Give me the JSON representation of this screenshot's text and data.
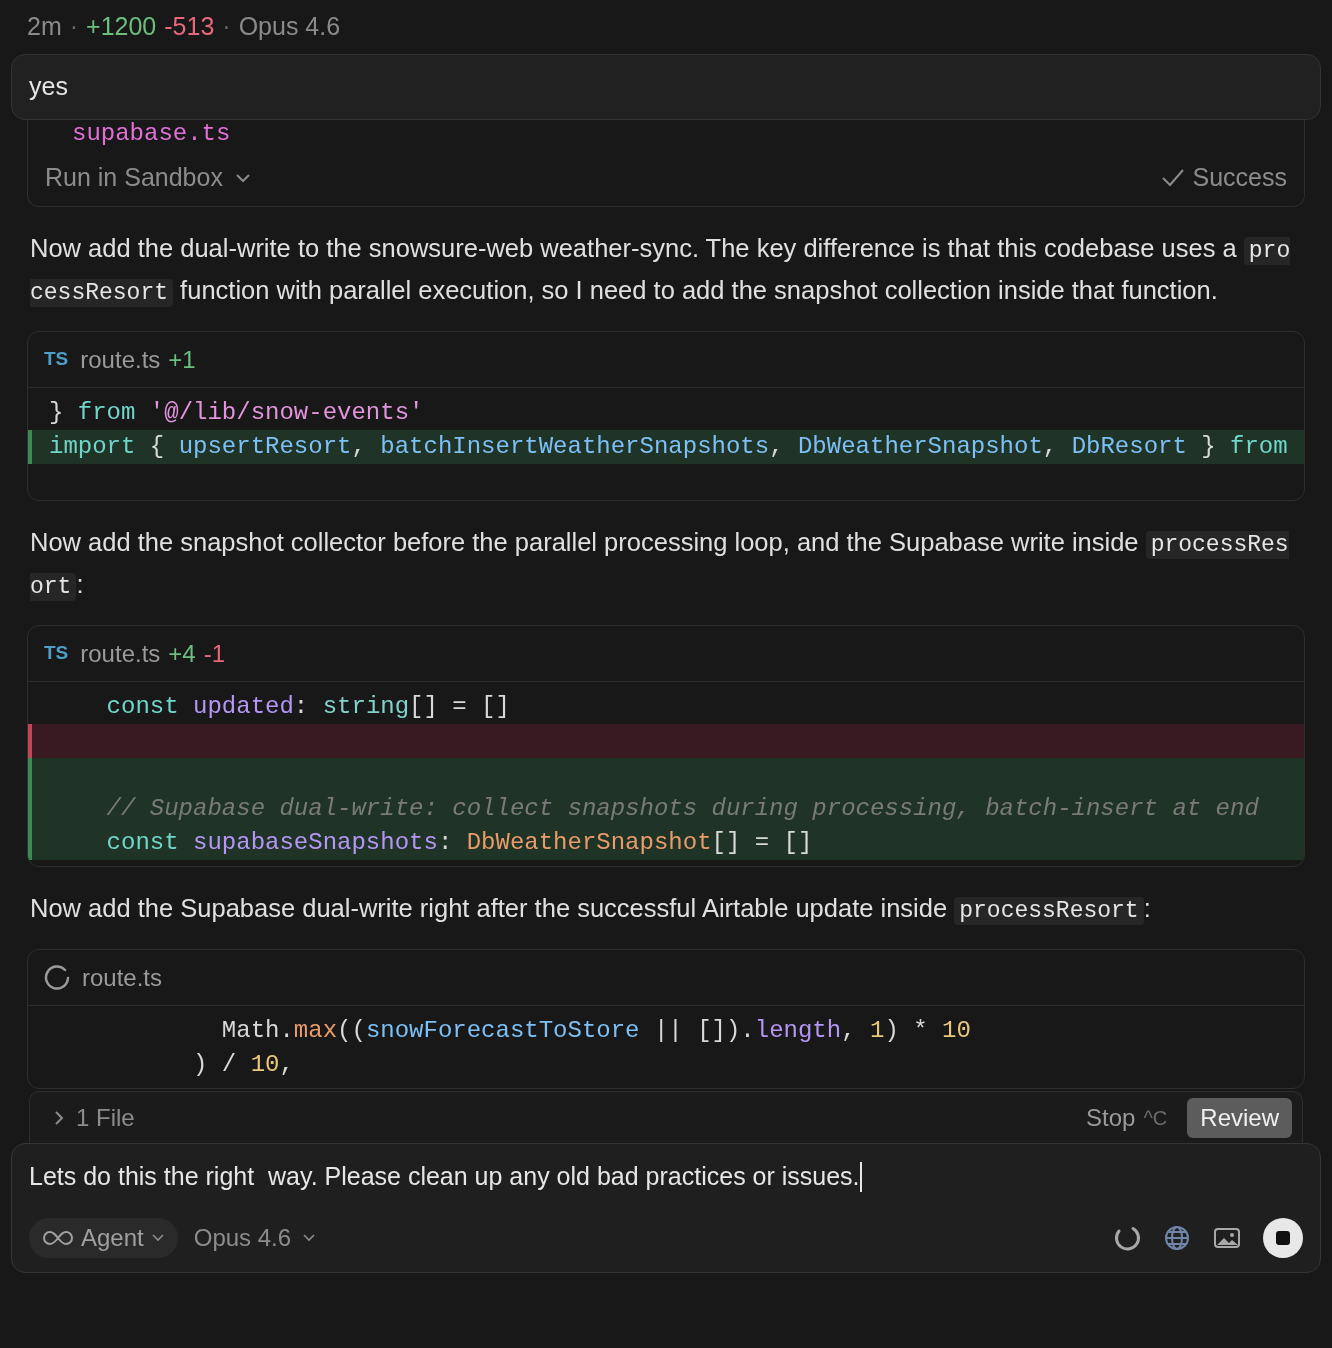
{
  "meta": [
    {
      "kind": "muted",
      "text": "2m"
    },
    {
      "kind": "sep",
      "text": "·"
    },
    {
      "kind": "added",
      "text": "+1200"
    },
    {
      "kind": "removed",
      "text": "-513"
    },
    {
      "kind": "sep",
      "text": "·"
    },
    {
      "kind": "muted",
      "text": "Opus 4.6"
    }
  ],
  "user_message": "yes",
  "tool_card": {
    "code_line": "supabase.ts",
    "action": "Run in Sandbox",
    "status": "Success"
  },
  "blocks": [
    {
      "kind": "text",
      "parts": [
        {
          "kind": "plain",
          "text": "Now add the dual-write to the snowsure-web weather-sync. The key difference is that this codebase uses a "
        },
        {
          "kind": "code",
          "text": "processResort"
        },
        {
          "kind": "plain",
          "text": " function with parallel execution, so I need to add the snapshot collection inside that function."
        }
      ]
    },
    {
      "kind": "code",
      "lang": "TS",
      "file": "route.ts",
      "added": "+1",
      "loading": false,
      "lines": [
        {
          "kind": "context",
          "tokens": [
            {
              "kind": "plain",
              "text": "} "
            },
            {
              "kind": "kw",
              "text": "from "
            },
            {
              "kind": "str",
              "text": "'@/lib/snow-events'"
            }
          ]
        },
        {
          "kind": "added",
          "tokens": [
            {
              "kind": "kw",
              "text": "import"
            },
            {
              "kind": "plain",
              "text": " { "
            },
            {
              "kind": "id",
              "text": "upsertResort"
            },
            {
              "kind": "plain",
              "text": ", "
            },
            {
              "kind": "id",
              "text": "batchInsertWeatherSnapshots"
            },
            {
              "kind": "plain",
              "text": ", "
            },
            {
              "kind": "id",
              "text": "DbWeatherSnapshot"
            },
            {
              "kind": "plain",
              "text": ", "
            },
            {
              "kind": "id",
              "text": "DbResort"
            },
            {
              "kind": "plain",
              "text": " } "
            },
            {
              "kind": "kw",
              "text": "from"
            }
          ]
        }
      ]
    },
    {
      "kind": "text",
      "parts": [
        {
          "kind": "plain",
          "text": "Now add the snapshot collector before the parallel processing loop, and the Supabase write inside "
        },
        {
          "kind": "code",
          "text": "processResort"
        },
        {
          "kind": "plain",
          "text": ":"
        }
      ]
    },
    {
      "kind": "code",
      "lang": "TS",
      "file": "route.ts",
      "added": "+4",
      "removed": "-1",
      "loading": false,
      "lines": [
        {
          "kind": "context",
          "tokens": [
            {
              "kind": "kw",
              "text": "    const "
            },
            {
              "kind": "prop",
              "text": "updated"
            },
            {
              "kind": "plain",
              "text": ": "
            },
            {
              "kind": "type",
              "text": "string"
            },
            {
              "kind": "plain",
              "text": "[] = []"
            }
          ]
        },
        {
          "kind": "removed"
        },
        {
          "kind": "added"
        },
        {
          "kind": "added",
          "tokens": [
            {
              "kind": "comment",
              "text": "    // Supabase dual-write: collect snapshots during processing, batch-insert at end"
            }
          ]
        },
        {
          "kind": "added",
          "tokens": [
            {
              "kind": "kw",
              "text": "    const "
            },
            {
              "kind": "prop",
              "text": "supabaseSnapshots"
            },
            {
              "kind": "plain",
              "text": ": "
            },
            {
              "kind": "fn",
              "text": "DbWeatherSnapshot"
            },
            {
              "kind": "plain",
              "text": "[] = []"
            }
          ]
        }
      ]
    },
    {
      "kind": "text",
      "parts": [
        {
          "kind": "plain",
          "text": "Now add the Supabase dual-write right after the successful Airtable update inside "
        },
        {
          "kind": "code",
          "text": "processResort"
        },
        {
          "kind": "plain",
          "text": ":"
        }
      ]
    },
    {
      "kind": "code",
      "file": "route.ts",
      "loading": true,
      "lines": [
        {
          "kind": "context",
          "tokens": [
            {
              "kind": "plain",
              "text": "            Math."
            },
            {
              "kind": "fn",
              "text": "max"
            },
            {
              "kind": "plain",
              "text": "(("
            },
            {
              "kind": "id",
              "text": "snowForecastToStore"
            },
            {
              "kind": "plain",
              "text": " || [])."
            },
            {
              "kind": "prop",
              "text": "length"
            },
            {
              "kind": "plain",
              "text": ", "
            },
            {
              "kind": "num",
              "text": "1"
            },
            {
              "kind": "plain",
              "text": ") * "
            },
            {
              "kind": "num",
              "text": "10"
            }
          ]
        },
        {
          "kind": "context",
          "tokens": [
            {
              "kind": "plain",
              "text": "          ) / "
            },
            {
              "kind": "num",
              "text": "10"
            },
            {
              "kind": "plain",
              "text": ","
            }
          ]
        }
      ]
    }
  ],
  "changes_bar": {
    "files": "1 File",
    "stop": "Stop",
    "shortcut": "^C",
    "review": "Review"
  },
  "composer": {
    "value": "Lets do this the right  way. Please clean up any old bad practices or issues.",
    "mode": "Agent",
    "model": "Opus 4.6"
  }
}
